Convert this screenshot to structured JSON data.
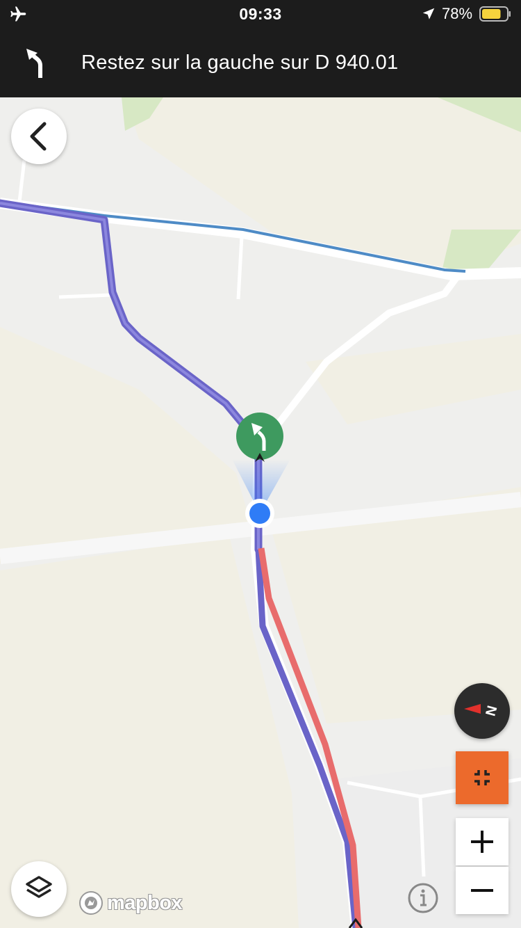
{
  "status_bar": {
    "time": "09:33",
    "battery_percent": "78%",
    "battery_level": 0.78,
    "icons": [
      "airplane-mode-icon",
      "location-arrow-icon",
      "battery-icon"
    ]
  },
  "navigation": {
    "instruction": "Restez sur la gauche sur D 940.01",
    "maneuver_icon": "turn-slight-left-icon"
  },
  "map": {
    "attribution": "mapbox",
    "colors": {
      "route": "#6a64c8",
      "traffic": "#e86c6c",
      "maneuver": "#3e9a5f",
      "user_location": "#2f7cf6",
      "recenter": "#ec6a2c"
    }
  },
  "controls": {
    "back_icon": "chevron-left-icon",
    "layers_icon": "layers-icon",
    "compass_label": "N",
    "recenter_icon": "collapse-arrows-icon",
    "zoom_in_label": "+",
    "zoom_out_label": "−",
    "info_icon": "info-icon"
  }
}
